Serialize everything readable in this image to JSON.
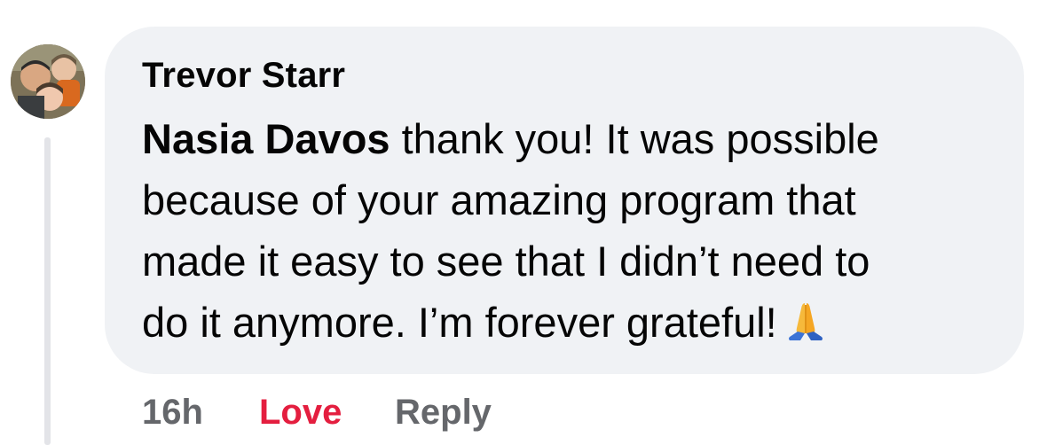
{
  "comment": {
    "author": "Trevor Starr",
    "mention": "Nasia Davos",
    "text_lines": [
      " thank you! It was possible",
      "because of your amazing program that",
      "made it easy to see that I didn’t need to",
      "do it anymore. I’m forever grateful!"
    ],
    "emoji": "folded-hands-icon",
    "timestamp": "16h",
    "reaction_label": "Love",
    "reply_label": "Reply"
  },
  "colors": {
    "bubble": "#f0f2f5",
    "text": "#050505",
    "secondary": "#65676b",
    "love": "#e41e3f",
    "thread_line": "#e3e4e8"
  }
}
